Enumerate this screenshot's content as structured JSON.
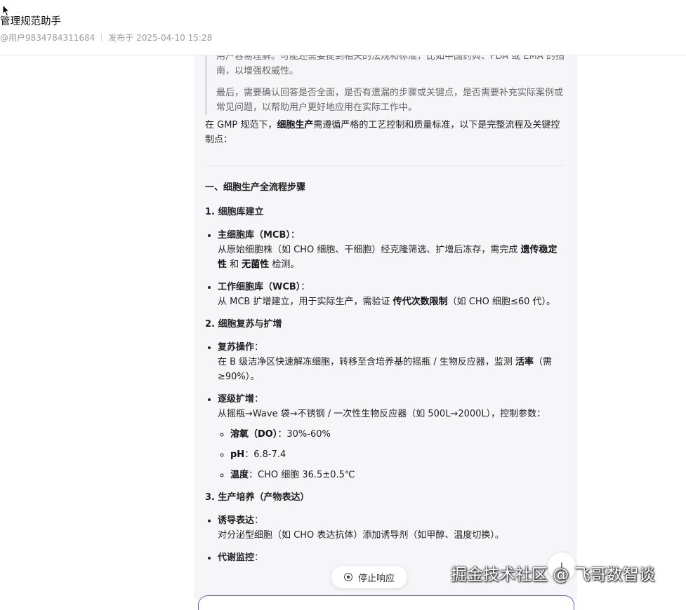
{
  "header": {
    "title": "管理规范助手",
    "user": "@用户9834784311684",
    "published": "发布于 2025-04-10 15:28"
  },
  "quote": {
    "p1": "用户容易理解。可能还需要提到相关的法规和标准，比如中国药典、FDA 或 EMA 的指南，以增强权威性。",
    "p2": "最后，需要确认回答是否全面，是否有遗漏的步骤或关键点，是否需要补充实际案例或常见问题，以帮助用户更好地应用在实际工作中。"
  },
  "intro": {
    "before": "在 GMP 规范下，",
    "bold": "细胞生产",
    "after": "需遵循严格的工艺控制和质量标准，以下是完整流程及关键控制点："
  },
  "section1": {
    "title": "一、细胞生产全流程步骤",
    "sub1": {
      "title": "1. 细胞库建立",
      "mcb_title": "主细胞库（MCB）",
      "mcb_t1": "从原始细胞株（如 CHO 细胞、干细胞）经克隆筛选、扩增后冻存，需完成 ",
      "mcb_b1": "遗传稳定性",
      "mcb_t2": " 和 ",
      "mcb_b2": "无菌性",
      "mcb_t3": " 检测。",
      "wcb_title": "工作细胞库（WCB）",
      "wcb_t1": "从 MCB 扩增建立，用于实际生产，需验证 ",
      "wcb_b1": "传代次数限制",
      "wcb_t2": "（如 CHO 细胞≤60 代）。"
    },
    "sub2": {
      "title": "2. 细胞复苏与扩增",
      "revive_title": "复苏操作",
      "revive_t1": "在 B 级洁净区快速解冻细胞，转移至含培养基的摇瓶 / 生物反应器，监测 ",
      "revive_b1": "活率",
      "revive_t2": "（需≥90%）。",
      "expand_title": "逐级扩增",
      "expand_t1": "从摇瓶→Wave 袋→不锈钢 / 一次性生物反应器（如 500L→2000L），控制参数：",
      "params": [
        {
          "label": "溶氧（DO）",
          "value": "30%-60%"
        },
        {
          "label": "pH",
          "value": "6.8-7.4"
        },
        {
          "label": "温度",
          "value": "CHO 细胞 36.5±0.5℃"
        }
      ]
    },
    "sub3": {
      "title": "3. 生产培养（产物表达）",
      "induce_title": "诱导表达",
      "induce_t1": "对分泌型细胞（如 CHO 表达抗体）添加诱导剂（如甲醇、温度切换）。",
      "monitor_title": "代谢监控"
    }
  },
  "controls": {
    "stop_label": "停止响应"
  },
  "watermark": "掘金技术社区 @ 飞哥数智谈"
}
